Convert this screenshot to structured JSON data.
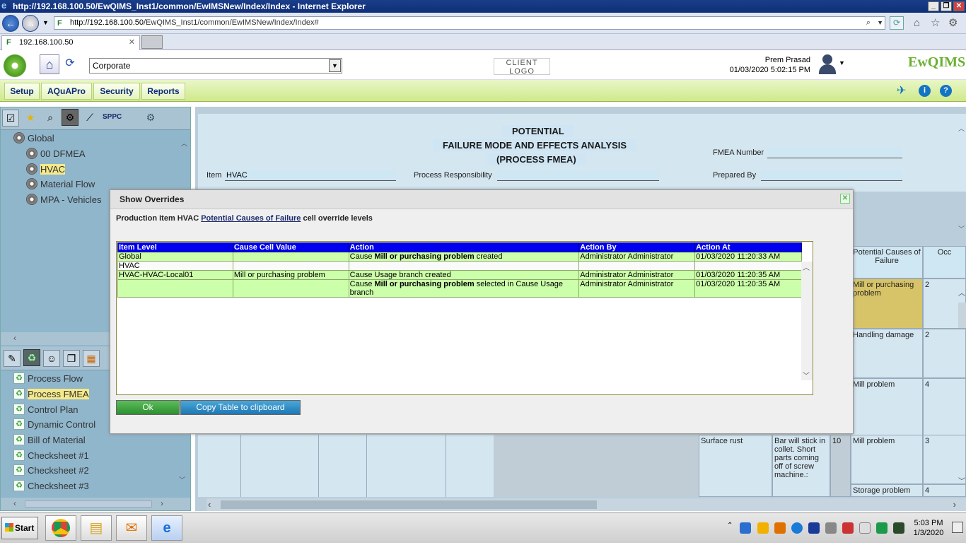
{
  "browser": {
    "window_title": "http://192.168.100.50/EwQIMS_Inst1/common/EwIMSNew/Index/Index - Internet Explorer",
    "address_host": "http://192.168.100.50",
    "address_path": "/EwQIMS_Inst1/common/EwIMSNew/Index/Index#",
    "tab_label": "192.168.100.50"
  },
  "header": {
    "corporate_select": "Corporate",
    "client_logo": "CLIENT LOGO",
    "user_name": "Prem Prasad",
    "user_datetime": "01/03/2020 5:02:15 PM",
    "brand": "EwQIMS"
  },
  "menu": [
    "Setup",
    "AQuAPro",
    "Security",
    "Reports"
  ],
  "left_toolbar": {
    "sppc_label": "SPPC"
  },
  "tree": [
    "Global",
    "00 DFMEA",
    "HVAC",
    "Material Flow",
    "MPA - Vehicles"
  ],
  "docs": [
    "Process Flow",
    "Process FMEA",
    "Control Plan",
    "Dynamic Control",
    "Bill of Material",
    "Checksheet #1",
    "Checksheet #2",
    "Checksheet #3"
  ],
  "form": {
    "title1": "POTENTIAL",
    "title2": "FAILURE MODE AND EFFECTS ANALYSIS",
    "title3": "(PROCESS FMEA)",
    "item_label": "Item",
    "item_value": "HVAC",
    "process_resp_label": "Process Responsibility",
    "fmea_number_label": "FMEA Number",
    "prepared_by_label": "Prepared By"
  },
  "grid": {
    "col_causes": "Potential Causes of Failure",
    "col_occ": "Occ",
    "causes": [
      "Mill or purchasing problem",
      "Handling damage",
      "Mill problem",
      "Mill problem",
      "Storage problem"
    ],
    "occ": [
      "2",
      "2",
      "4",
      "3",
      "4"
    ],
    "surface_rust": "Surface rust",
    "effect_text": "Bar will stick in collet. Short parts coming off of screw machine.:",
    "sev": "10"
  },
  "modal": {
    "title": "Show Overrides",
    "subtitle_prefix": "Production Item HVAC",
    "subtitle_link": "Potential Causes of Failure",
    "subtitle_suffix": "cell override levels",
    "columns": [
      "Item Level",
      "Cause Cell Value",
      "Action",
      "Action By",
      "Action At"
    ],
    "rows": [
      {
        "level": "Global",
        "value": "",
        "action_pre": "Cause",
        "action_bold": "Mill or purchasing problem",
        "action_post": "created",
        "by": "Administrator Administrator",
        "at": "01/03/2020 11:20:33 AM"
      },
      {
        "level": "HVAC",
        "value": "",
        "action_pre": "",
        "action_bold": "",
        "action_post": "",
        "by": "",
        "at": ""
      },
      {
        "level": "HVAC-HVAC-Local01",
        "value": "Mill or purchasing problem",
        "action_pre": "Cause Usage branch created",
        "action_bold": "",
        "action_post": "",
        "by": "Administrator Administrator",
        "at": "01/03/2020 11:20:35 AM"
      },
      {
        "level": "",
        "value": "",
        "action_pre": "Cause",
        "action_bold": "Mill or purchasing problem",
        "action_post": "selected in Cause Usage branch",
        "by": "Administrator Administrator",
        "at": "01/03/2020 11:20:35 AM"
      }
    ],
    "ok_label": "Ok",
    "copy_label": "Copy Table to clipboard"
  },
  "taskbar": {
    "start_label": "Start",
    "time": "5:03 PM",
    "date": "1/3/2020"
  }
}
